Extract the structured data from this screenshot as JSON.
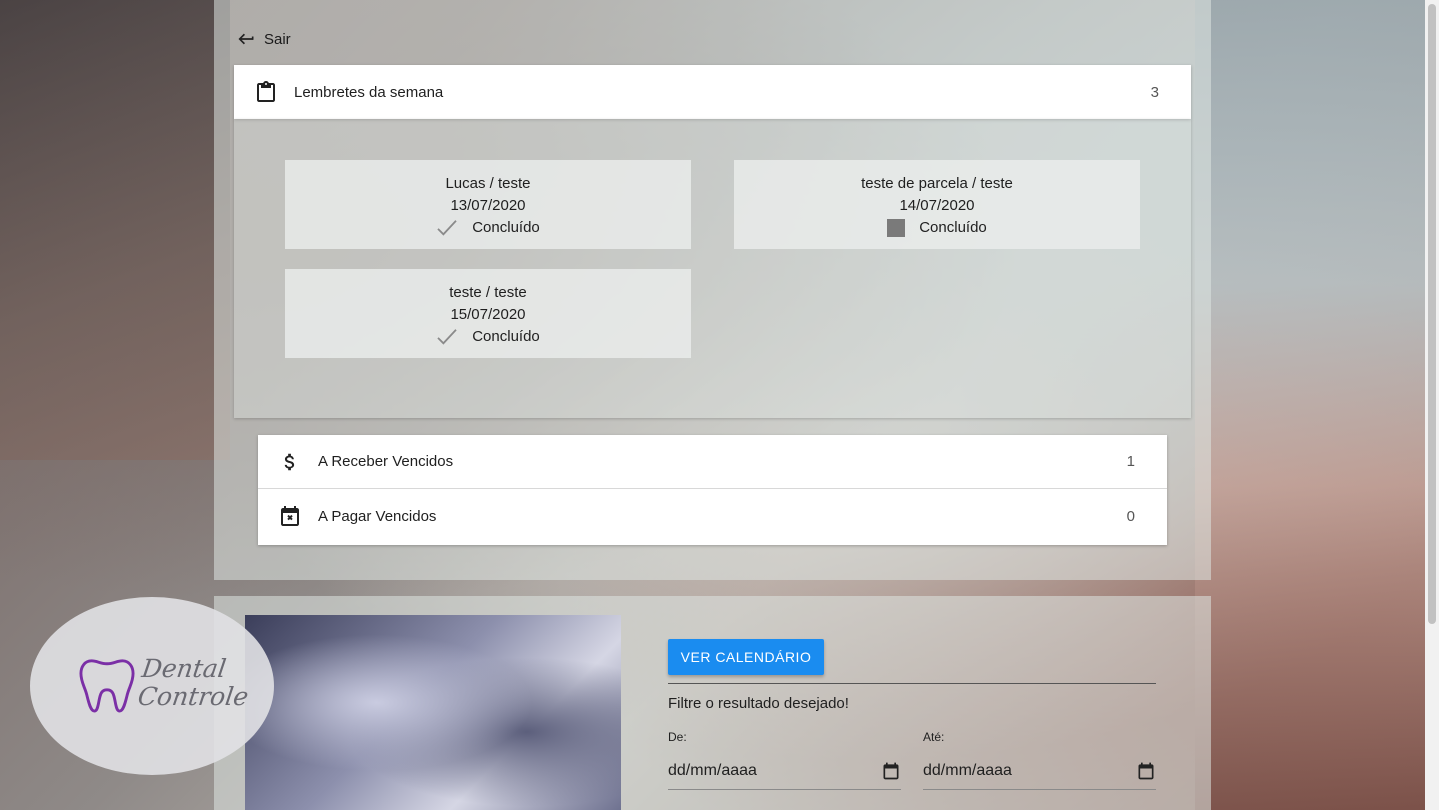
{
  "nav": {
    "back_label": "Sair"
  },
  "reminders": {
    "title": "Lembretes da semana",
    "count": "3",
    "items": [
      {
        "title": "Lucas / teste",
        "date": "13/07/2020",
        "status": "Concluído",
        "done": true
      },
      {
        "title": "teste de parcela / teste",
        "date": "14/07/2020",
        "status": "Concluído",
        "done": false
      },
      {
        "title": "teste / teste",
        "date": "15/07/2020",
        "status": "Concluído",
        "done": true
      }
    ]
  },
  "overdue": {
    "receivable_label": "A Receber Vencidos",
    "receivable_count": "1",
    "payable_label": "A Pagar Vencidos",
    "payable_count": "0"
  },
  "logo": {
    "text_line1": "Dental",
    "text_line2": "Controle"
  },
  "filter": {
    "calendar_button": "VER CALENDÁRIO",
    "hint": "Filtre o resultado desejado!",
    "from_label": "De:",
    "to_label": "Até:",
    "from_placeholder": "dd/mm/aaaa",
    "to_placeholder": "dd/mm/aaaa"
  },
  "icons": {
    "back": "arrow-back-icon",
    "clipboard": "clipboard-icon",
    "dollar": "dollar-icon",
    "calendar_x": "calendar-remove-icon",
    "check": "check-icon",
    "calendar": "calendar-icon"
  },
  "colors": {
    "primary_button": "#1a8cf0",
    "logo_purple": "#7b2fa6"
  }
}
